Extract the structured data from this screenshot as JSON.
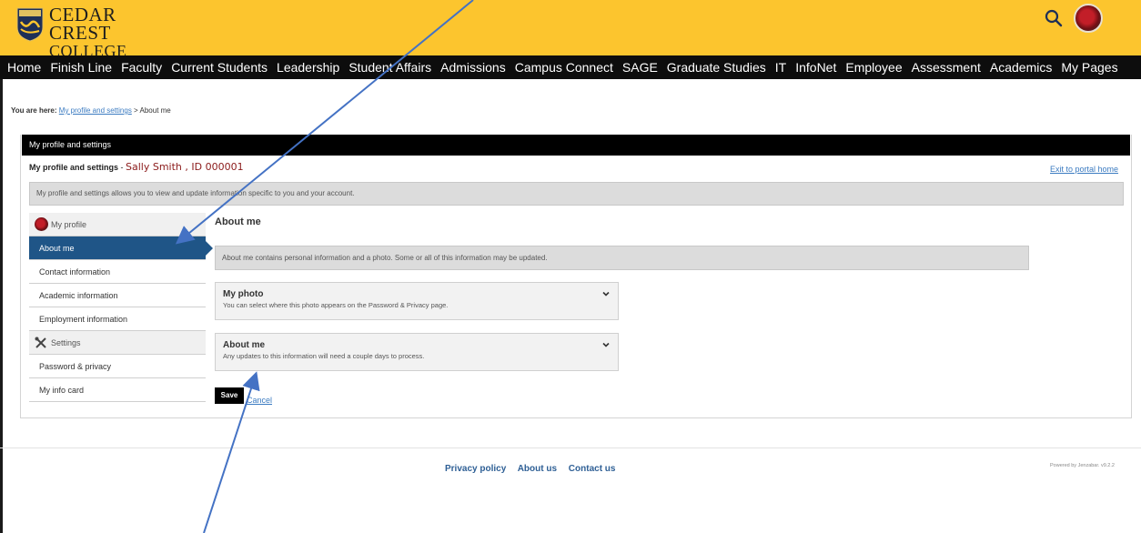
{
  "header": {
    "logo_line1": "CEDAR CREST",
    "logo_line2": "COLLEGE",
    "accent_color": "#fcc52e",
    "search_icon": "search-icon"
  },
  "nav": {
    "items": [
      "Home",
      "Finish Line",
      "Faculty",
      "Current Students",
      "Leadership",
      "Student Affairs",
      "Admissions",
      "Campus Connect",
      "SAGE",
      "Graduate Studies",
      "IT",
      "InfoNet",
      "Employee",
      "Assessment",
      "Academics",
      "My Pages"
    ]
  },
  "breadcrumb": {
    "prefix": "You are here:",
    "link": "My profile and settings",
    "separator": " > ",
    "current": "About me"
  },
  "panel": {
    "title": "My profile and settings",
    "profile_label": "My profile and settings",
    "profile_separator": " - ",
    "profile_name": "Sally Smith , ID 000001",
    "exit_link": "Exit to portal home",
    "intro": "My profile and settings allows you to view and update information specific to you and your account."
  },
  "sidebar": {
    "group1": "My profile",
    "items1": [
      "About me",
      "Contact information",
      "Academic information",
      "Employment information"
    ],
    "group2": "Settings",
    "items2": [
      "Password & privacy",
      "My info card"
    ],
    "active_color": "#1f5587"
  },
  "content": {
    "title": "About me",
    "intro": "About me contains personal information and a photo. Some or all of this information may be updated.",
    "card1_title": "My photo",
    "card1_sub": "You can select where this photo appears on the Password & Privacy page.",
    "card2_title": "About me",
    "card2_sub": "Any updates to this information will need a couple days to process.",
    "save": "Save",
    "cancel": "Cancel"
  },
  "footer": {
    "links": [
      "Privacy policy",
      "About us",
      "Contact us"
    ],
    "powered": "Powered by Jenzabar. v9.2.2"
  }
}
